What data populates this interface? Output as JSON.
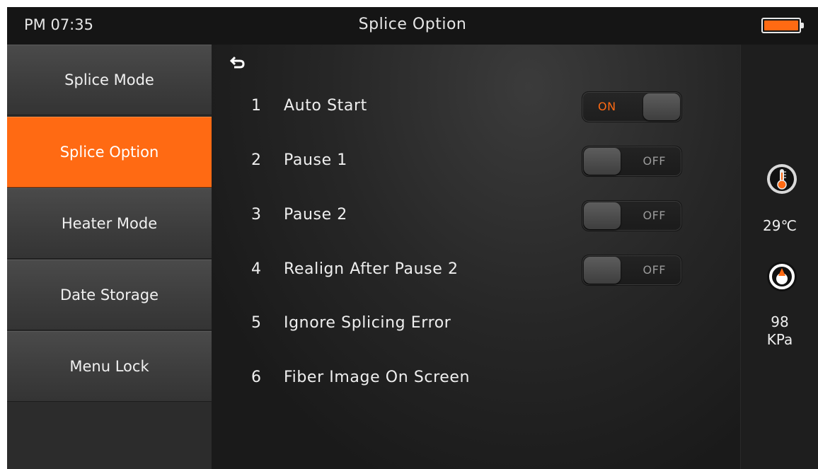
{
  "status_bar": {
    "time": "PM 07:35",
    "title": "Splice Option",
    "battery_icon": "battery-icon",
    "battery_level": 1.0,
    "battery_color": "#ff6a13"
  },
  "sidebar": {
    "items": [
      {
        "label": "Splice Mode",
        "active": false
      },
      {
        "label": "Splice Option",
        "active": true
      },
      {
        "label": "Heater Mode",
        "active": false
      },
      {
        "label": "Date Storage",
        "active": false
      },
      {
        "label": "Menu Lock",
        "active": false
      }
    ],
    "active_color": "#ff6a13"
  },
  "main": {
    "back_icon": "back-arrow-icon",
    "options": [
      {
        "number": "1",
        "label": "Auto Start",
        "toggle": "ON"
      },
      {
        "number": "2",
        "label": "Pause 1",
        "toggle": "OFF"
      },
      {
        "number": "3",
        "label": "Pause 2",
        "toggle": "OFF"
      },
      {
        "number": "4",
        "label": "Realign After Pause 2",
        "toggle": "OFF"
      },
      {
        "number": "5",
        "label": "Ignore Splicing Error"
      },
      {
        "number": "6",
        "label": "Fiber Image On Screen"
      }
    ]
  },
  "sensors": {
    "temperature_icon": "thermometer-icon",
    "temperature": "29℃",
    "pressure_icon": "pressure-gauge-icon",
    "pressure_value": "98",
    "pressure_unit": "KPa"
  }
}
